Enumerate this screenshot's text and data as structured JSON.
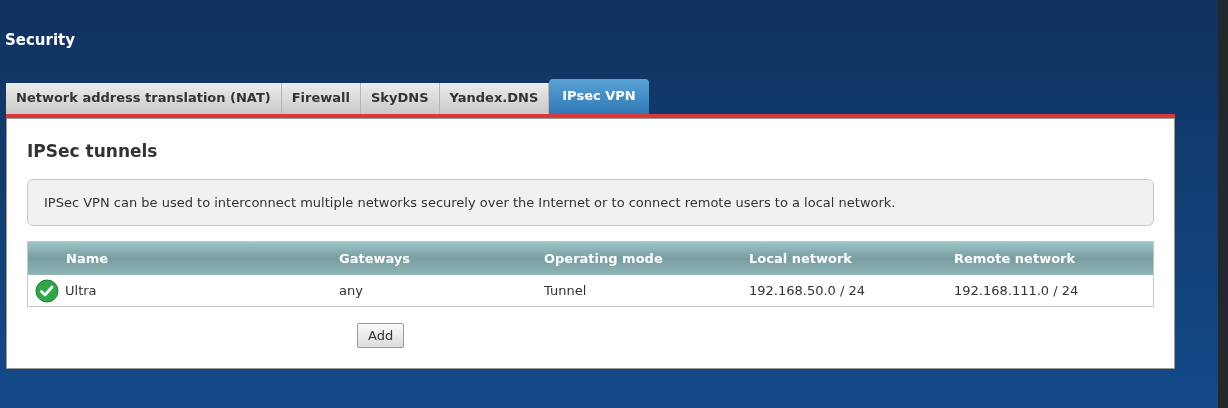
{
  "page_title": "Security",
  "tabs": [
    {
      "label": "Network address translation (NAT)",
      "selected": false
    },
    {
      "label": "Firewall",
      "selected": false
    },
    {
      "label": "SkyDNS",
      "selected": false
    },
    {
      "label": "Yandex.DNS",
      "selected": false
    },
    {
      "label": "IPsec VPN",
      "selected": true
    }
  ],
  "section": {
    "heading": "IPSec tunnels",
    "info": "IPSec VPN can be used to interconnect multiple networks securely over the Internet or to connect remote users to a local network."
  },
  "table": {
    "columns": [
      "Name",
      "Gateways",
      "Operating mode",
      "Local network",
      "Remote network"
    ],
    "rows": [
      {
        "enabled": true,
        "cells": [
          "Ultra",
          "any",
          "Tunnel",
          "192.168.50.0 / 24",
          "192.168.111.0 / 24"
        ]
      }
    ]
  },
  "add_button": "Add"
}
